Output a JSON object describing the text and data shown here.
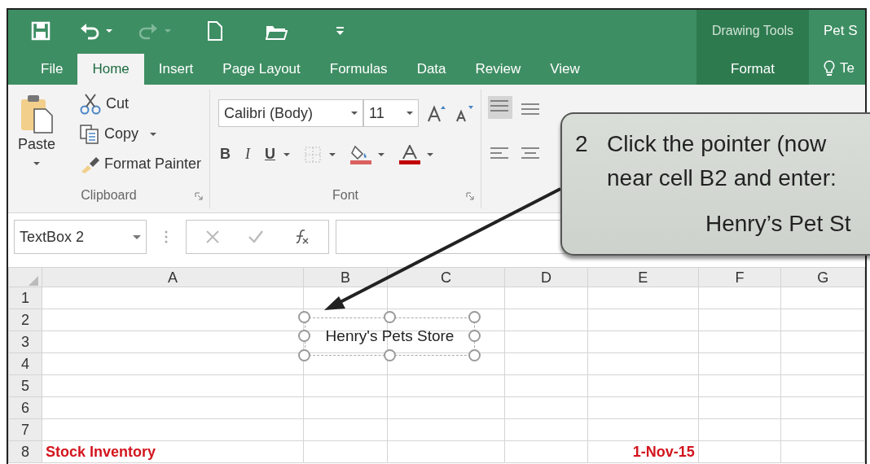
{
  "title_bar": {
    "title": "Pet S"
  },
  "contextual": {
    "group": "Drawing Tools",
    "tab": {
      "label": "Format",
      "selected": false
    }
  },
  "tabs": [
    {
      "label": "File",
      "selected": false
    },
    {
      "label": "Home",
      "selected": true
    },
    {
      "label": "Insert",
      "selected": false
    },
    {
      "label": "Page Layout",
      "selected": false
    },
    {
      "label": "Formulas",
      "selected": false
    },
    {
      "label": "Data",
      "selected": false
    },
    {
      "label": "Review",
      "selected": false
    },
    {
      "label": "View",
      "selected": false
    }
  ],
  "tell_me": {
    "label": "Te"
  },
  "ribbon": {
    "clipboard": {
      "paste": "Paste",
      "cut": "Cut",
      "copy": "Copy",
      "format_painter": "Format Painter",
      "label": "Clipboard"
    },
    "font": {
      "font_name": "Calibri (Body)",
      "font_size": "11",
      "bold": "B",
      "italic": "I",
      "underline": "U",
      "label": "Font"
    }
  },
  "formula_bar": {
    "name_box": "TextBox 2"
  },
  "sheet": {
    "columns": [
      "A",
      "B",
      "C",
      "D",
      "E",
      "F",
      "G"
    ],
    "rows": [
      {
        "number": "1"
      },
      {
        "number": "2"
      },
      {
        "number": "3"
      },
      {
        "number": "4"
      },
      {
        "number": "5"
      },
      {
        "number": "6"
      },
      {
        "number": "7"
      },
      {
        "number": "8",
        "cells": [
          "Stock Inventory",
          null,
          null,
          null,
          "1-Nov-15",
          null,
          null
        ]
      }
    ],
    "textbox": {
      "text": "Henry's Pets Store",
      "selected": true
    }
  },
  "callout": {
    "step": "2",
    "lines": [
      "Click the pointer (now",
      "near cell B2 and enter:"
    ],
    "entry": "Henry’s Pet St"
  }
}
